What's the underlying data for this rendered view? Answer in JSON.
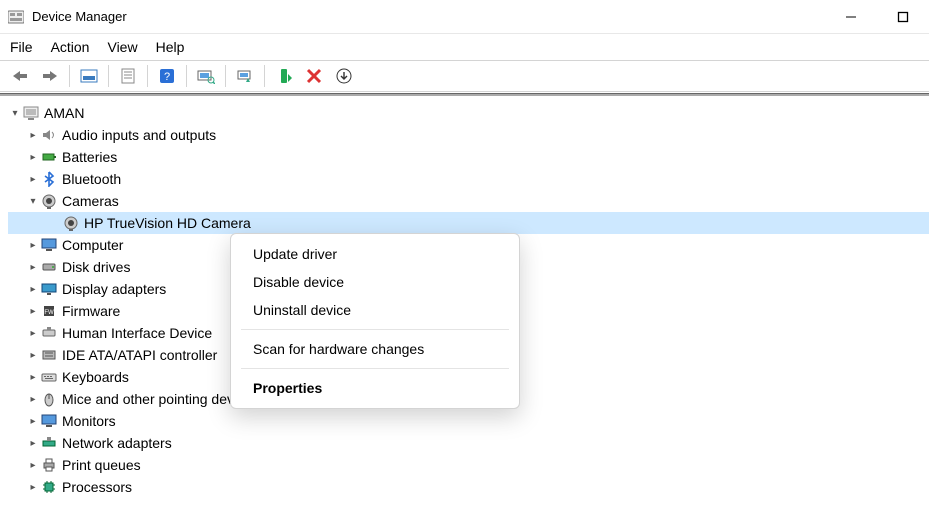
{
  "window": {
    "title": "Device Manager"
  },
  "menu": {
    "file": "File",
    "action": "Action",
    "view": "View",
    "help": "Help"
  },
  "tree": {
    "root": "AMAN",
    "nodes": {
      "audio": "Audio inputs and outputs",
      "batteries": "Batteries",
      "bluetooth": "Bluetooth",
      "cameras": "Cameras",
      "camera_device": "HP TrueVision HD Camera",
      "computer": "Computer",
      "disk": "Disk drives",
      "display": "Display adapters",
      "firmware": "Firmware",
      "hid": "Human Interface Device",
      "ide": "IDE ATA/ATAPI controller",
      "keyboards": "Keyboards",
      "mice": "Mice and other pointing devices",
      "monitors": "Monitors",
      "network": "Network adapters",
      "printq": "Print queues",
      "processors": "Processors"
    }
  },
  "context": {
    "update": "Update driver",
    "disable": "Disable device",
    "uninstall": "Uninstall device",
    "scan": "Scan for hardware changes",
    "properties": "Properties"
  }
}
